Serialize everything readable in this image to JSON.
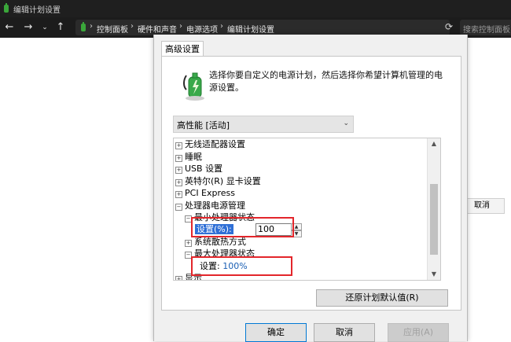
{
  "window": {
    "title": "编辑计划设置"
  },
  "nav": {
    "back_icon": "back-arrow-icon",
    "forward_icon": "forward-arrow-icon",
    "recent_icon": "chevron-down-icon",
    "up_icon": "up-arrow-icon",
    "breadcrumbs": [
      "控制面板",
      "硬件和声音",
      "电源选项",
      "编辑计划设置"
    ],
    "search_placeholder": "搜索控制面板"
  },
  "background": {
    "cancel_label": "取消"
  },
  "dialog": {
    "tab_label": "高级设置",
    "description": "选择你要自定义的电源计划，然后选择你希望计算机管理的电源设置。",
    "plan_selected": "高性能 [活动]",
    "tree": {
      "wireless": "无线适配器设置",
      "sleep": "睡眠",
      "usb": "USB 设置",
      "intel": "英特尔(R) 显卡设置",
      "pci": "PCI Express",
      "processor": "处理器电源管理",
      "min_state": "最小处理器状态",
      "setting_label": "设置(%):",
      "min_value": "100",
      "cooling": "系统散热方式",
      "max_state": "最大处理器状态",
      "max_setting": "设置:",
      "max_value": "100%",
      "display": "显示"
    },
    "restore_label": "还原计划默认值(R)",
    "ok_label": "确定",
    "cancel_label": "取消",
    "apply_label": "应用(A)"
  },
  "colors": {
    "highlight_box": "#e3262b",
    "selection": "#2f6fd6",
    "value_text": "#1a5fb4"
  }
}
